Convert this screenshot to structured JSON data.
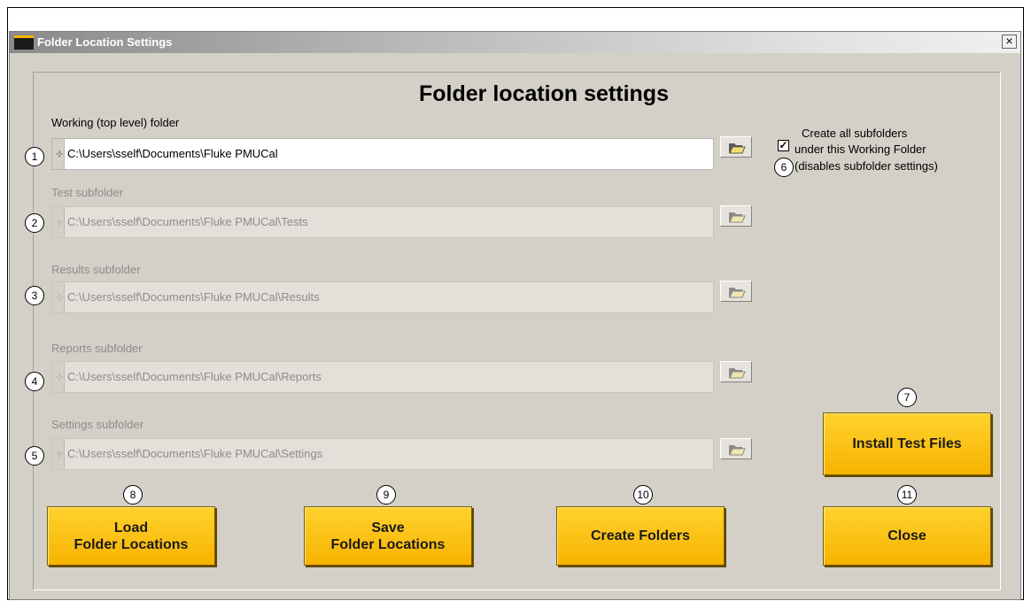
{
  "window": {
    "title": "Folder Location Settings",
    "close_glyph": "×"
  },
  "heading": "Folder location settings",
  "folders": [
    {
      "label": "Working (top level) folder",
      "path": "C:\\Users\\sself\\Documents\\Fluke PMUCal",
      "enabled": true,
      "callout": "1"
    },
    {
      "label": "Test subfolder",
      "path": "C:\\Users\\sself\\Documents\\Fluke PMUCal\\Tests",
      "enabled": false,
      "callout": "2"
    },
    {
      "label": "Results subfolder",
      "path": "C:\\Users\\sself\\Documents\\Fluke PMUCal\\Results",
      "enabled": false,
      "callout": "3"
    },
    {
      "label": "Reports subfolder",
      "path": "C:\\Users\\sself\\Documents\\Fluke PMUCal\\Reports",
      "enabled": false,
      "callout": "4"
    },
    {
      "label": "Settings subfolder",
      "path": "C:\\Users\\sself\\Documents\\Fluke PMUCal\\Settings",
      "enabled": false,
      "callout": "5"
    }
  ],
  "subfolder_option": {
    "checked": true,
    "check_glyph": "✓",
    "line1": "Create all subfolders",
    "line2": "under this Working Folder",
    "line3": "(disables subfolder settings)",
    "callout": "6"
  },
  "buttons": {
    "install": {
      "label": "Install Test Files",
      "callout": "7"
    },
    "load": {
      "line1": "Load",
      "line2": "Folder Locations",
      "callout": "8"
    },
    "save": {
      "line1": "Save",
      "line2": "Folder Locations",
      "callout": "9"
    },
    "create": {
      "label": "Create Folders",
      "callout": "10"
    },
    "close": {
      "label": "Close",
      "callout": "11"
    }
  },
  "colors": {
    "button_yellow": "#f7b300",
    "dialog_bg": "#d4d0c8",
    "disabled_text": "#8c8c8c"
  },
  "icons": {
    "folder_browse": "folder-open-icon",
    "path_tree": "tree-icon"
  }
}
